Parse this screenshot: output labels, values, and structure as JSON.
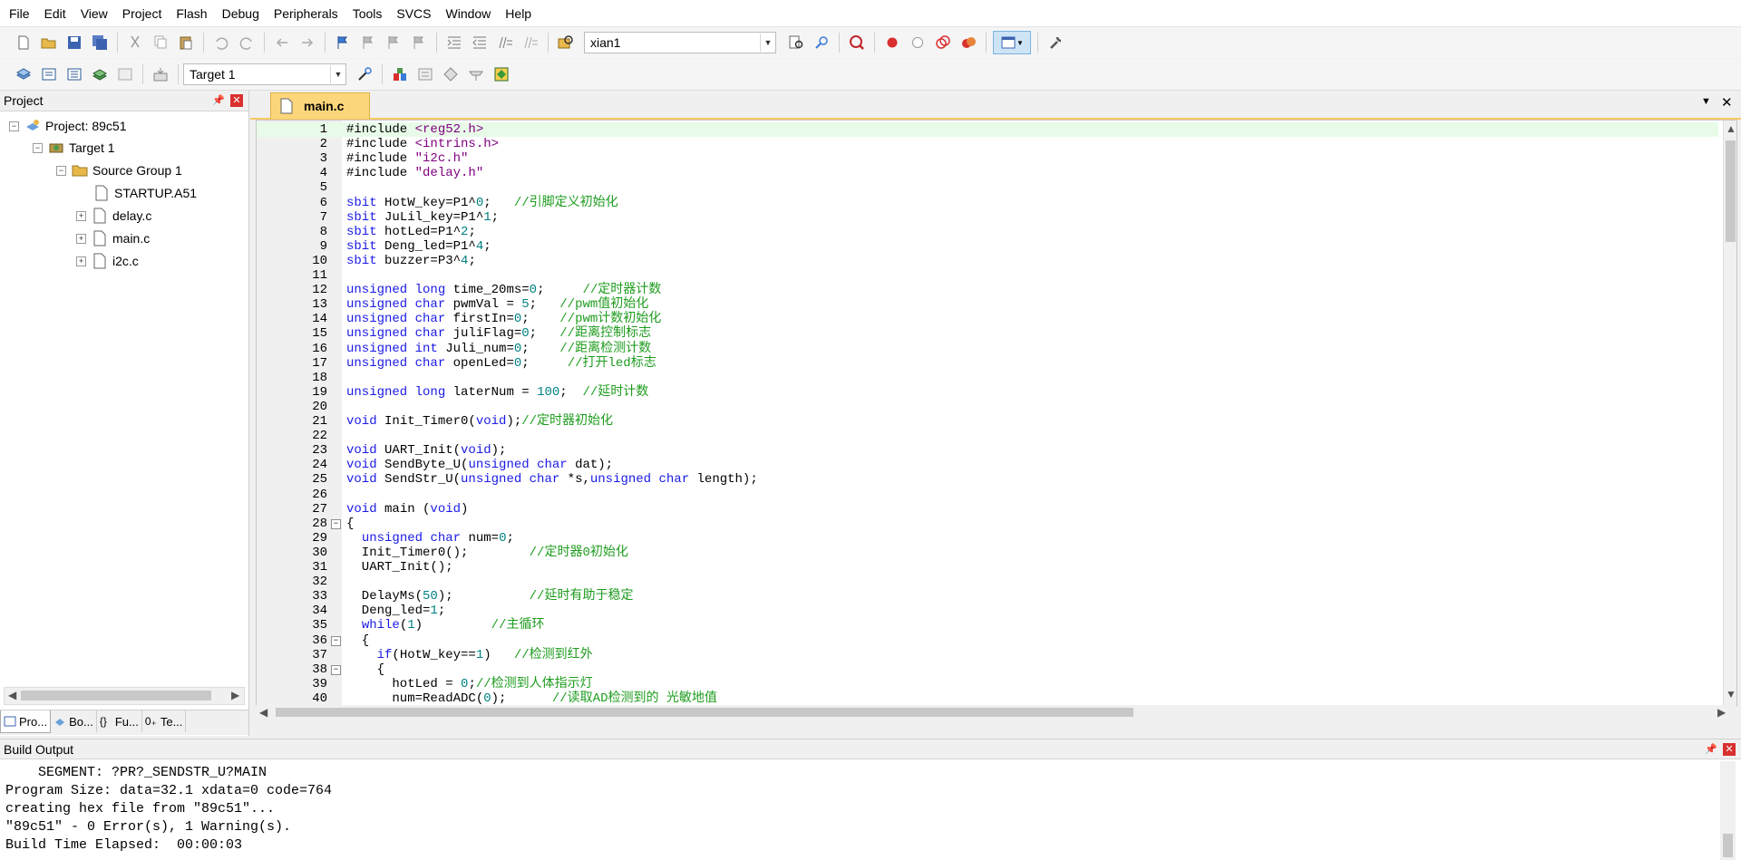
{
  "menu": [
    "File",
    "Edit",
    "View",
    "Project",
    "Flash",
    "Debug",
    "Peripherals",
    "Tools",
    "SVCS",
    "Window",
    "Help"
  ],
  "toolbar": {
    "find_value": "xian1",
    "target_value": "Target 1"
  },
  "project_panel": {
    "title": "Project",
    "tree": {
      "project": "Project: 89c51",
      "target": "Target 1",
      "group": "Source Group 1",
      "files": [
        "STARTUP.A51",
        "delay.c",
        "main.c",
        "i2c.c"
      ]
    },
    "tabs": [
      "Pro...",
      "Bo...",
      "Fu...",
      "Te..."
    ]
  },
  "editor": {
    "tab_label": "main.c",
    "lines": [
      {
        "n": "1",
        "code": "#include <reg52.h>"
      },
      {
        "n": "2",
        "code": "#include <intrins.h>"
      },
      {
        "n": "3",
        "code": "#include \"i2c.h\""
      },
      {
        "n": "4",
        "code": "#include \"delay.h\""
      },
      {
        "n": "5",
        "code": ""
      },
      {
        "n": "6",
        "code": "sbit HotW_key=P1^0;   //引脚定义初始化"
      },
      {
        "n": "7",
        "code": "sbit JuLil_key=P1^1;"
      },
      {
        "n": "8",
        "code": "sbit hotLed=P1^2;"
      },
      {
        "n": "9",
        "code": "sbit Deng_led=P1^4;"
      },
      {
        "n": "10",
        "code": "sbit buzzer=P3^4;"
      },
      {
        "n": "11",
        "code": ""
      },
      {
        "n": "12",
        "code": "unsigned long time_20ms=0;     //定时器计数"
      },
      {
        "n": "13",
        "code": "unsigned char pwmVal = 5;   //pwm值初始化"
      },
      {
        "n": "14",
        "code": "unsigned char firstIn=0;    //pwm计数初始化"
      },
      {
        "n": "15",
        "code": "unsigned char juliFlag=0;   //距离控制标志"
      },
      {
        "n": "16",
        "code": "unsigned int Juli_num=0;    //距离检测计数"
      },
      {
        "n": "17",
        "code": "unsigned char openLed=0;     //打开led标志"
      },
      {
        "n": "18",
        "code": ""
      },
      {
        "n": "19",
        "code": "unsigned long laterNum = 100;  //延时计数"
      },
      {
        "n": "20",
        "code": ""
      },
      {
        "n": "21",
        "code": "void Init_Timer0(void);//定时器初始化"
      },
      {
        "n": "22",
        "code": ""
      },
      {
        "n": "23",
        "code": "void UART_Init(void);"
      },
      {
        "n": "24",
        "code": "void SendByte_U(unsigned char dat);"
      },
      {
        "n": "25",
        "code": "void SendStr_U(unsigned char *s,unsigned char length);"
      },
      {
        "n": "26",
        "code": ""
      },
      {
        "n": "27",
        "code": "void main (void)"
      },
      {
        "n": "28",
        "code": "{"
      },
      {
        "n": "29",
        "code": "  unsigned char num=0;"
      },
      {
        "n": "30",
        "code": "  Init_Timer0();        //定时器0初始化"
      },
      {
        "n": "31",
        "code": "  UART_Init();"
      },
      {
        "n": "32",
        "code": ""
      },
      {
        "n": "33",
        "code": "  DelayMs(50);          //延时有助于稳定"
      },
      {
        "n": "34",
        "code": "  Deng_led=1;"
      },
      {
        "n": "35",
        "code": "  while(1)         //主循环"
      },
      {
        "n": "36",
        "code": "  {"
      },
      {
        "n": "37",
        "code": "    if(HotW_key==1)   //检测到红外"
      },
      {
        "n": "38",
        "code": "    {"
      },
      {
        "n": "39",
        "code": "      hotLed = 0;//检测到人体指示灯"
      },
      {
        "n": "40",
        "code": "      num=ReadADC(0);      //读取AD检测到的 光敏地值"
      }
    ]
  },
  "build_output": {
    "title": "Build Output",
    "lines": [
      "    SEGMENT: ?PR?_SENDSTR_U?MAIN",
      "Program Size: data=32.1 xdata=0 code=764",
      "creating hex file from \"89c51\"...",
      "\"89c51\" - 0 Error(s), 1 Warning(s).",
      "Build Time Elapsed:  00:00:03"
    ]
  },
  "colors": {
    "keyword": "#1a1ae6",
    "comment": "#1e9c1e",
    "number": "#008080",
    "string": "#800080",
    "tab_active": "#fcd67a"
  }
}
